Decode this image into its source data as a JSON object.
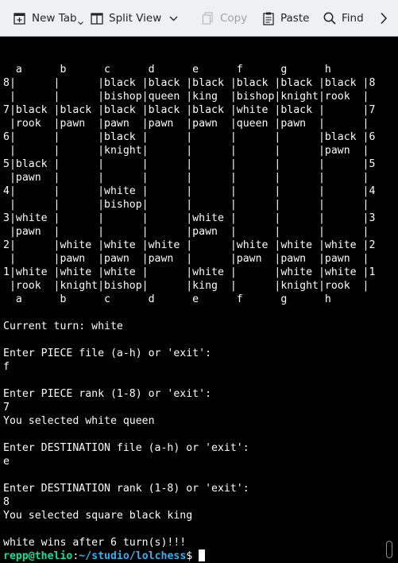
{
  "toolbar": {
    "new_tab": "New Tab",
    "split_view": "Split View",
    "copy": "Copy",
    "paste": "Paste",
    "find": "Find"
  },
  "icons": {
    "new_tab": "new-tab-icon",
    "split_view": "split-view-icon",
    "copy": "copy-icon",
    "paste": "paste-icon",
    "find": "search-icon",
    "more": "chevron-right-icon"
  },
  "terminal": {
    "lines": [
      "",
      "  a      b      c      d      e      f      g      h",
      "8|      |      |black |black |black |black |black |black |8",
      " |      |      |bishop|queen |king  |bishop|knight|rook  |",
      "7|black |black |black |black |black |white |black |      |7",
      " |rook  |pawn  |pawn  |pawn  |pawn  |queen |pawn  |      |",
      "6|      |      |black |      |      |      |      |black |6",
      " |      |      |knight|      |      |      |      |pawn  |",
      "5|black |      |      |      |      |      |      |      |5",
      " |pawn  |      |      |      |      |      |      |      |",
      "4|      |      |white |      |      |      |      |      |4",
      " |      |      |bishop|      |      |      |      |      |",
      "3|white |      |      |      |white |      |      |      |3",
      " |pawn  |      |      |      |pawn  |      |      |      |",
      "2|      |white |white |white |      |white |white |white |2",
      " |      |pawn  |pawn  |pawn  |      |pawn  |pawn  |pawn  |",
      "1|white |white |white |      |white |      |white |white |1",
      " |rook  |knight|bishop|      |king  |      |knight|rook  |",
      "  a      b      c      d      e      f      g      h",
      "",
      "Current turn: white",
      "",
      "Enter PIECE file (a-h) or 'exit':",
      "f",
      "",
      "Enter PIECE rank (1-8) or 'exit':",
      "7",
      "You selected white queen",
      "",
      "Enter DESTINATION file (a-h) or 'exit':",
      "e",
      "",
      "Enter DESTINATION rank (1-8) or 'exit':",
      "8",
      "You selected square black king",
      "",
      "white wins after 6 turn(s)!!!"
    ],
    "prompt": {
      "user_host": "repp@thelio",
      "separator": ":",
      "path": "~/studio/lolchess",
      "symbol": "$"
    }
  },
  "colors": {
    "background": "#000000",
    "text": "#fcfcfc",
    "prompt_user": "#1cdc9a",
    "prompt_path": "#3daee9"
  }
}
